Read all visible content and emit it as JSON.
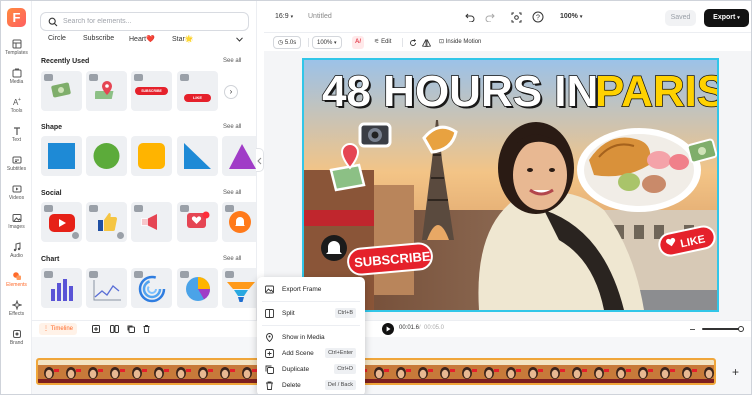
{
  "app": {
    "title": "Untitled",
    "saved_label": "Saved",
    "export_label": "Export",
    "ratio": "16:9",
    "zoom": "100%"
  },
  "rail": [
    {
      "label": "Templates",
      "icon": "templates-icon"
    },
    {
      "label": "Media",
      "icon": "media-icon"
    },
    {
      "label": "Tools",
      "icon": "tools-icon"
    },
    {
      "label": "Text",
      "icon": "text-icon"
    },
    {
      "label": "Subtitles",
      "icon": "subtitles-icon"
    },
    {
      "label": "Videos",
      "icon": "videos-icon"
    },
    {
      "label": "Images",
      "icon": "images-icon"
    },
    {
      "label": "Audio",
      "icon": "audio-icon"
    },
    {
      "label": "Elements",
      "icon": "elements-icon",
      "active": true
    },
    {
      "label": "Effects",
      "icon": "effects-icon"
    },
    {
      "label": "Brand",
      "icon": "brand-icon"
    }
  ],
  "panel": {
    "search_placeholder": "Search for elements...",
    "chips": [
      "Circle",
      "Subscribe",
      "Heart❤️",
      "Star🌟"
    ],
    "sections": [
      {
        "title": "Recently Used",
        "see_all": "See all"
      },
      {
        "title": "Shape",
        "see_all": "See all"
      },
      {
        "title": "Social",
        "see_all": "See all"
      },
      {
        "title": "Chart",
        "see_all": "See all"
      }
    ],
    "recent_chips": {
      "subscribe": "SUBSCRIBE",
      "like": "LIKE"
    }
  },
  "toolbar": {
    "duration": "5.0s",
    "zoom": "100%",
    "edit": "Edit",
    "inside_motion": "Inside Motion"
  },
  "canvas": {
    "headline_white": "48 HOURS IN",
    "headline_yellow": "PARIS",
    "subscribe_sticker": "SUBSCRIBE",
    "like_sticker": "LIKE",
    "colors": {
      "accent": "#ff6a2a",
      "selection": "#31c6e8",
      "headline_yellow": "#ffd200",
      "subscribe_red": "#e5212b"
    }
  },
  "timeline": {
    "label": "Timeline",
    "current_time": "00:01.6",
    "total_time": "00:05.0"
  },
  "context_menu": [
    {
      "label": "Export Frame",
      "icon": "export-frame-icon",
      "shortcut": ""
    },
    {
      "label": "Split",
      "icon": "split-icon",
      "shortcut": "Ctrl+B"
    },
    {
      "label": "Show in Media",
      "icon": "location-pin-icon",
      "shortcut": ""
    },
    {
      "label": "Add Scene",
      "icon": "add-scene-icon",
      "shortcut": "Ctrl+Enter"
    },
    {
      "label": "Duplicate",
      "icon": "duplicate-icon",
      "shortcut": "Ctrl+D"
    },
    {
      "label": "Delete",
      "icon": "trash-icon",
      "shortcut": "Del / Back"
    }
  ]
}
